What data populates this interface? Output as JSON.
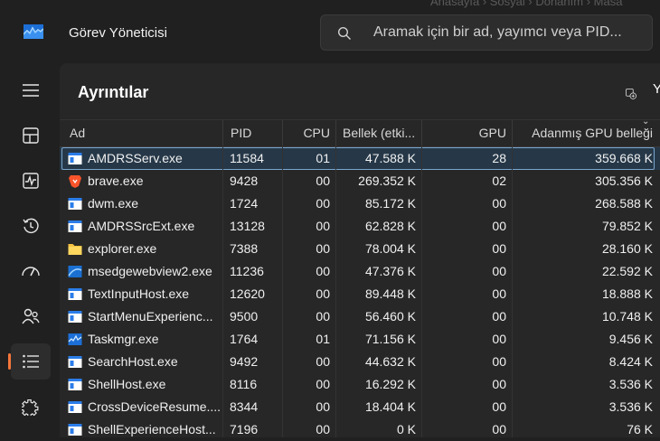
{
  "window": {
    "title": "Görev Yöneticisi",
    "ghost_breadcrumb": "Anasayfa  ›  Sosyal  ›  Donanım  ›  Masa"
  },
  "search": {
    "placeholder": "Aramak için bir ad, yayımcı veya PID..."
  },
  "sidebar": {
    "items": [
      {
        "icon": "hamburger-menu-icon"
      },
      {
        "icon": "processes-icon"
      },
      {
        "icon": "performance-icon"
      },
      {
        "icon": "app-history-icon"
      },
      {
        "icon": "startup-apps-icon"
      },
      {
        "icon": "users-icon"
      },
      {
        "icon": "details-icon",
        "active": true
      },
      {
        "icon": "services-icon"
      }
    ],
    "accent": "#f4763b"
  },
  "panel": {
    "title": "Ayrıntılar",
    "new_task_label": "Y"
  },
  "table": {
    "columns": {
      "name": "Ad",
      "pid": "PID",
      "cpu": "CPU",
      "memory": "Bellek (etki...",
      "gpu": "GPU",
      "gpu_memory": "Adanmış GPU belleği"
    },
    "rows": [
      {
        "name": "AMDRSServ.exe",
        "pid": "11584",
        "cpu": "01",
        "memory": "47.588 K",
        "gpu": "28",
        "gpu_memory": "359.668 K",
        "icon": "app-window-icon",
        "selected": true
      },
      {
        "name": "brave.exe",
        "pid": "9428",
        "cpu": "00",
        "memory": "269.352 K",
        "gpu": "02",
        "gpu_memory": "305.356 K",
        "icon": "brave-icon"
      },
      {
        "name": "dwm.exe",
        "pid": "1724",
        "cpu": "00",
        "memory": "85.172 K",
        "gpu": "00",
        "gpu_memory": "268.588 K",
        "icon": "app-window-icon"
      },
      {
        "name": "AMDRSSrcExt.exe",
        "pid": "13128",
        "cpu": "00",
        "memory": "62.828 K",
        "gpu": "00",
        "gpu_memory": "79.852 K",
        "icon": "app-window-icon"
      },
      {
        "name": "explorer.exe",
        "pid": "7388",
        "cpu": "00",
        "memory": "78.004 K",
        "gpu": "00",
        "gpu_memory": "28.160 K",
        "icon": "folder-icon"
      },
      {
        "name": "msedgewebview2.exe",
        "pid": "11236",
        "cpu": "00",
        "memory": "47.376 K",
        "gpu": "00",
        "gpu_memory": "22.592 K",
        "icon": "edge-webview-icon"
      },
      {
        "name": "TextInputHost.exe",
        "pid": "12620",
        "cpu": "00",
        "memory": "89.448 K",
        "gpu": "00",
        "gpu_memory": "18.888 K",
        "icon": "app-window-icon"
      },
      {
        "name": "StartMenuExperienc...",
        "pid": "9500",
        "cpu": "00",
        "memory": "56.460 K",
        "gpu": "00",
        "gpu_memory": "10.748 K",
        "icon": "app-window-icon"
      },
      {
        "name": "Taskmgr.exe",
        "pid": "1764",
        "cpu": "01",
        "memory": "71.156 K",
        "gpu": "00",
        "gpu_memory": "9.456 K",
        "icon": "task-manager-icon"
      },
      {
        "name": "SearchHost.exe",
        "pid": "9492",
        "cpu": "00",
        "memory": "44.632 K",
        "gpu": "00",
        "gpu_memory": "8.424 K",
        "icon": "app-window-icon"
      },
      {
        "name": "ShellHost.exe",
        "pid": "8116",
        "cpu": "00",
        "memory": "16.292 K",
        "gpu": "00",
        "gpu_memory": "3.536 K",
        "icon": "app-window-icon"
      },
      {
        "name": "CrossDeviceResume....",
        "pid": "8344",
        "cpu": "00",
        "memory": "18.404 K",
        "gpu": "00",
        "gpu_memory": "3.536 K",
        "icon": "app-window-icon"
      },
      {
        "name": "ShellExperienceHost...",
        "pid": "7196",
        "cpu": "00",
        "memory": "0 K",
        "gpu": "00",
        "gpu_memory": "76 K",
        "icon": "app-window-icon"
      }
    ]
  }
}
